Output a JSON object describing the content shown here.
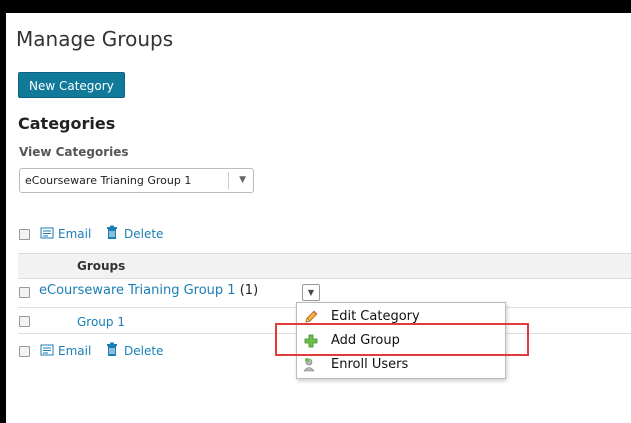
{
  "page": {
    "title": "Manage Groups"
  },
  "toolbar": {
    "new_category_label": "New Category"
  },
  "categories": {
    "heading": "Categories",
    "view_label": "View Categories",
    "selected": "eCourseware Trianing Group 1"
  },
  "actions": {
    "email_label": "Email",
    "delete_label": "Delete"
  },
  "table": {
    "column_header": "Groups",
    "category": {
      "name": "eCourseware Trianing Group 1",
      "count": "(1)"
    },
    "groups": [
      {
        "name": "Group 1"
      }
    ]
  },
  "context_menu": {
    "items": [
      {
        "label": "Edit Category",
        "icon": "pencil-icon"
      },
      {
        "label": "Add Group",
        "icon": "plus-icon"
      },
      {
        "label": "Enroll Users",
        "icon": "users-icon"
      }
    ]
  },
  "colors": {
    "accent": "#117a9b",
    "link": "#1a7db5",
    "highlight": "#e03a3a"
  }
}
